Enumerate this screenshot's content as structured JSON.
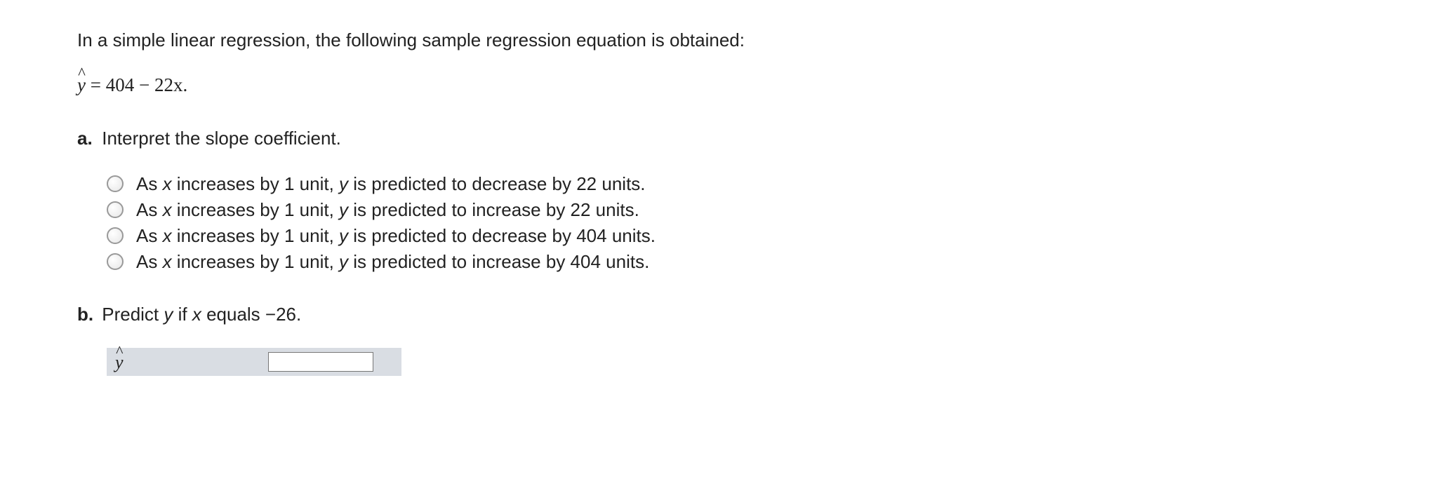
{
  "intro": "In a simple linear regression, the following sample regression equation is obtained:",
  "equation": {
    "lhs_var": "y",
    "rhs": "=  404 − 22x."
  },
  "part_a": {
    "label": "a.",
    "prompt_before": "Interpret the slope coefficient.",
    "options": [
      {
        "pre": "As ",
        "x": "x",
        "mid": " increases by 1 unit, ",
        "y": "y",
        "post": " is predicted to decrease by 22 units."
      },
      {
        "pre": "As ",
        "x": "x",
        "mid": " increases by 1 unit, ",
        "y": "y",
        "post": " is predicted to increase by 22 units."
      },
      {
        "pre": "As ",
        "x": "x",
        "mid": " increases by 1 unit, ",
        "y": "y",
        "post": " is predicted to decrease by 404 units."
      },
      {
        "pre": "As ",
        "x": "x",
        "mid": " increases by 1 unit, ",
        "y": "y",
        "post": " is predicted to increase by 404 units."
      }
    ]
  },
  "part_b": {
    "label": "b.",
    "prompt_pre": "Predict ",
    "y": "y",
    "prompt_mid": " if ",
    "x": "x",
    "prompt_post": " equals −26.",
    "answer_var": "y",
    "answer_value": ""
  }
}
